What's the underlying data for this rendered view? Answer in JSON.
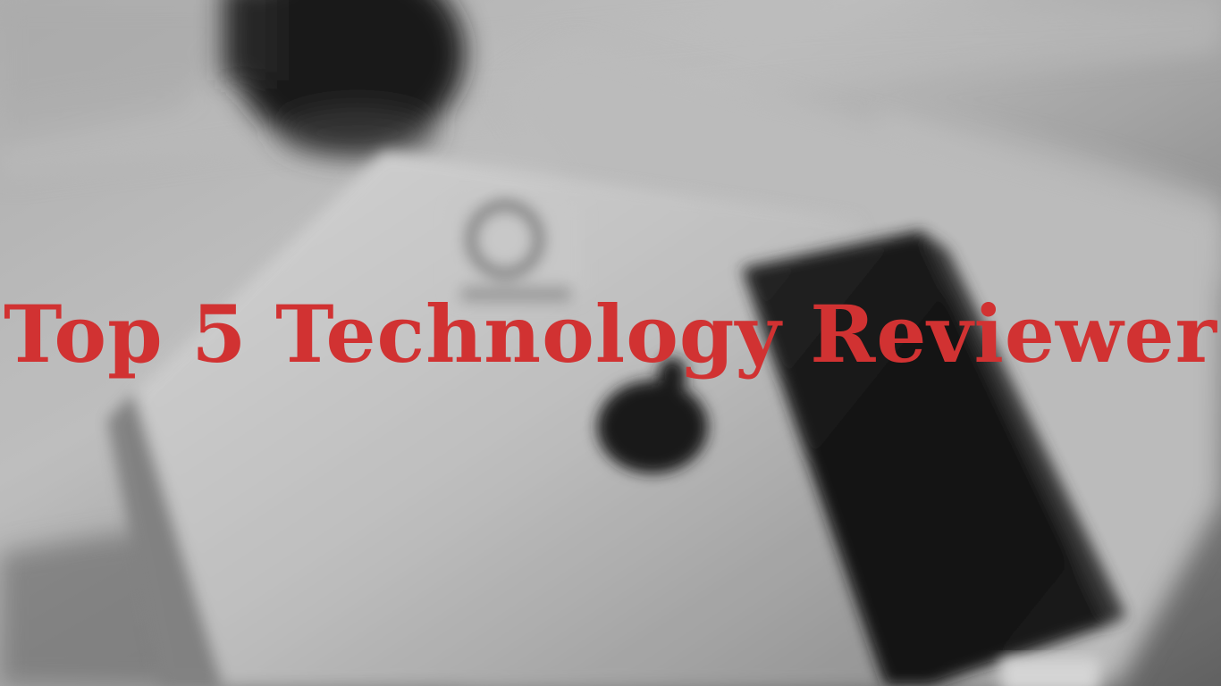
{
  "headline": {
    "text": "Top 5 Technology Reviewer",
    "color": "#d13232"
  },
  "background": {
    "description_free": true,
    "palette": {
      "table_light": "#d8d8d8",
      "table_mid": "#a9a9a9",
      "table_dark": "#5e5e5e",
      "laptop_light": "#e4e4e4",
      "laptop_mid": "#bdbdbd",
      "phone_dark": "#141414",
      "logo_dark": "#1c1c1c",
      "mug_dark": "#1e1e1e"
    }
  }
}
